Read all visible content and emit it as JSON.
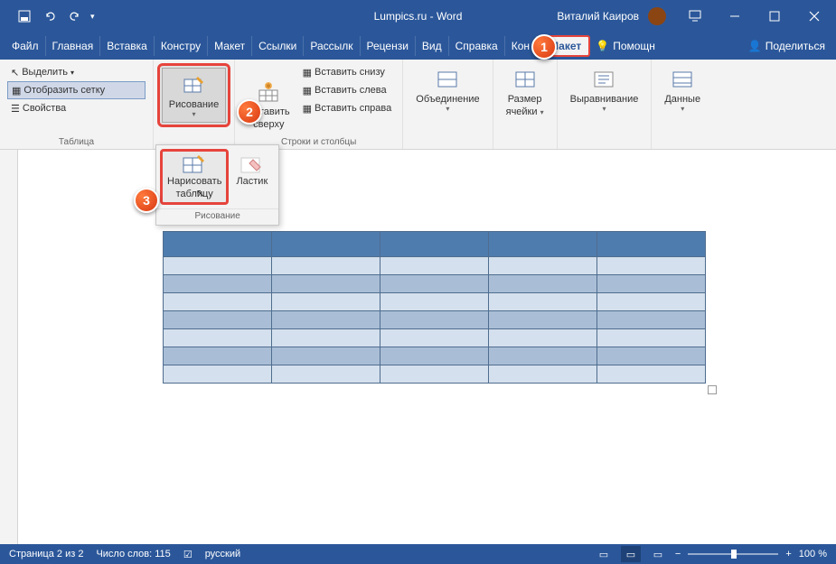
{
  "titlebar": {
    "title": "Lumpics.ru - Word",
    "user": "Виталий Каиров"
  },
  "menu": {
    "items": [
      "Файл",
      "Главная",
      "Вставка",
      "Констру",
      "Макет",
      "Ссылки",
      "Рассылк",
      "Рецензи",
      "Вид",
      "Справка",
      "Кон"
    ],
    "active": "Макет",
    "help": "Помощн",
    "share": "Поделиться"
  },
  "ribbon": {
    "group_table": {
      "label": "Таблица",
      "select": "Выделить",
      "grid": "Отобразить сетку",
      "props": "Свойства"
    },
    "group_draw": {
      "label": "Рисование"
    },
    "group_rowscols": {
      "label": "Строки и столбцы",
      "insert_top_1": "Вставить",
      "insert_top_2": "сверху",
      "insert_below": "Вставить снизу",
      "insert_left": "Вставить слева",
      "insert_right": "Вставить справа"
    },
    "group_merge": {
      "label": "Объединение"
    },
    "group_cellsize": {
      "label_1": "Размер",
      "label_2": "ячейки"
    },
    "group_align": {
      "label": "Выравнивание"
    },
    "group_data": {
      "label": "Данные"
    }
  },
  "dropdown": {
    "draw_table_1": "Нарисовать",
    "draw_table_2": "таблицу",
    "eraser": "Ластик",
    "label": "Рисование"
  },
  "status": {
    "page": "Страница 2 из 2",
    "words": "Число слов: 115",
    "lang": "русский",
    "zoom": "100 %"
  },
  "markers": {
    "m1": "1",
    "m2": "2",
    "m3": "3"
  }
}
